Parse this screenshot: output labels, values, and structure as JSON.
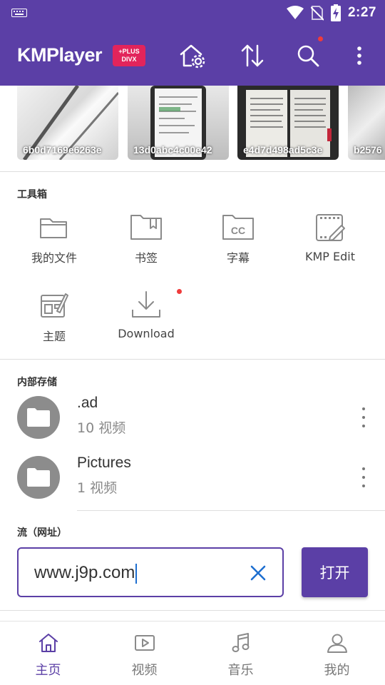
{
  "status_bar": {
    "time": "2:27"
  },
  "app_bar": {
    "logo_text": "KMPlayer",
    "badge_line1": "+PLUS",
    "badge_line2": "DIVX"
  },
  "thumbnails": [
    {
      "name": "6b0d7169e6263e"
    },
    {
      "name": "13d0abc4c00e42"
    },
    {
      "name": "e4d7d498ad5c3e"
    },
    {
      "name": "b2576"
    }
  ],
  "toolbox": {
    "title": "工具箱",
    "items": [
      {
        "label": "我的文件",
        "icon": "folder-icon"
      },
      {
        "label": "书签",
        "icon": "bookmark-icon"
      },
      {
        "label": "字幕",
        "icon": "subtitle-icon"
      },
      {
        "label": "KMP Edit",
        "icon": "edit-icon"
      },
      {
        "label": "主题",
        "icon": "theme-icon"
      },
      {
        "label": "Download",
        "icon": "download-icon"
      }
    ]
  },
  "storage": {
    "title": "内部存储",
    "folders": [
      {
        "name": ".ad",
        "count": "10 视频"
      },
      {
        "name": "Pictures",
        "count": "1 视频"
      }
    ]
  },
  "stream": {
    "title": "流（网址）",
    "url_value": "www.j9p.com",
    "open_label": "打开"
  },
  "bottom_nav": {
    "items": [
      {
        "label": "主页",
        "icon": "home-icon",
        "active": true
      },
      {
        "label": "视频",
        "icon": "video-icon",
        "active": false
      },
      {
        "label": "音乐",
        "icon": "music-icon",
        "active": false
      },
      {
        "label": "我的",
        "icon": "profile-icon",
        "active": false
      }
    ]
  },
  "colors": {
    "primary": "#5b3fa6",
    "badge": "#e2245b",
    "notification_dot": "#ef3b3b",
    "caret": "#1e6fd0"
  }
}
